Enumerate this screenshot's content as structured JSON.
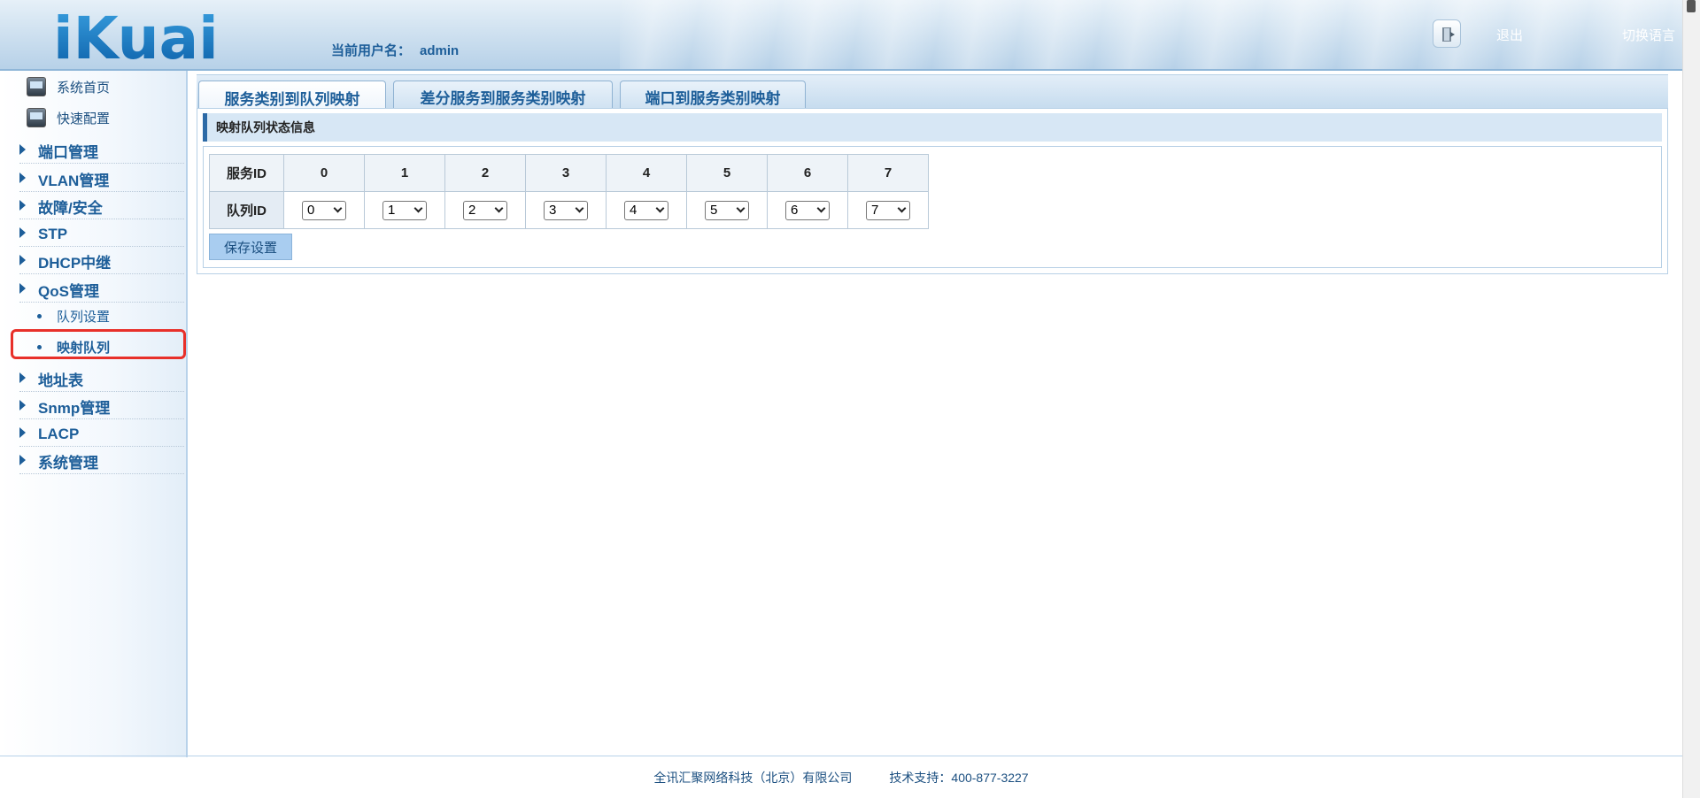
{
  "header": {
    "logo_text": "iKuai",
    "current_user_label": "当前用户名：",
    "current_user": "admin",
    "exit_label": "退出",
    "language_label": "切换语言"
  },
  "sidebar": {
    "quick": [
      {
        "label": "系统首页",
        "icon": "monitor-icon"
      },
      {
        "label": "快速配置",
        "icon": "printer-icon"
      }
    ],
    "menus": [
      {
        "label": "端口管理"
      },
      {
        "label": "VLAN管理"
      },
      {
        "label": "故障/安全"
      },
      {
        "label": "STP"
      },
      {
        "label": "DHCP中继"
      },
      {
        "label": "QoS管理"
      },
      {
        "label": "地址表"
      },
      {
        "label": "Snmp管理"
      },
      {
        "label": "LACP"
      },
      {
        "label": "系统管理"
      }
    ],
    "qos_sub": [
      {
        "label": "队列设置"
      },
      {
        "label": "映射队列",
        "active": true
      }
    ]
  },
  "tabs": [
    {
      "label": "服务类别到队列映射",
      "active": true
    },
    {
      "label": "差分服务到服务类别映射"
    },
    {
      "label": "端口到服务类别映射"
    }
  ],
  "section_title": "映射队列状态信息",
  "table": {
    "service_id_label": "服务ID",
    "queue_id_label": "队列ID",
    "service_ids": [
      "0",
      "1",
      "2",
      "3",
      "4",
      "5",
      "6",
      "7"
    ],
    "queue_ids": [
      "0",
      "1",
      "2",
      "3",
      "4",
      "5",
      "6",
      "7"
    ]
  },
  "save_button": "保存设置",
  "footer": {
    "company": "全讯汇聚网络科技（北京）有限公司",
    "support": "技术支持：400-877-3227"
  },
  "colors": {
    "brand_blue": "#1d5e99",
    "highlight_red": "#e8302a"
  }
}
